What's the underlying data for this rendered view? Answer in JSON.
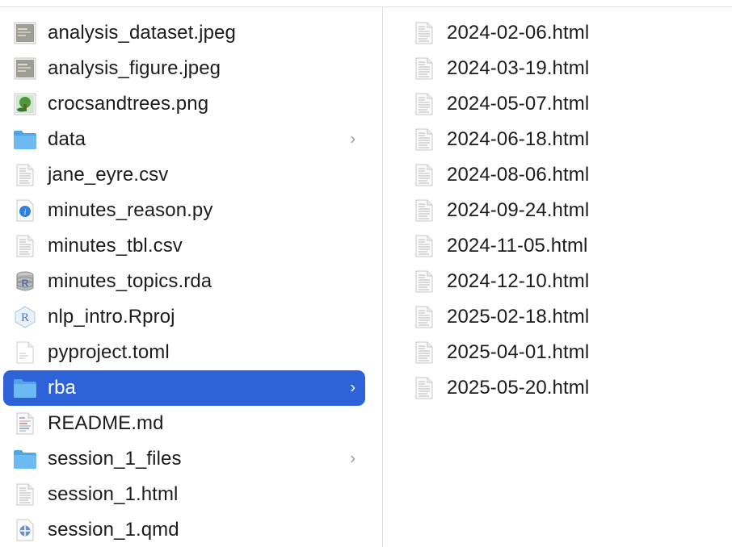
{
  "left_column": {
    "items": [
      {
        "name": "analysis_dataset.jpeg",
        "icon": "image-thumbnail-icon",
        "type": "image"
      },
      {
        "name": "analysis_figure.jpeg",
        "icon": "image-thumbnail-icon",
        "type": "image"
      },
      {
        "name": "crocsandtrees.png",
        "icon": "image-thumbnail-icon",
        "type": "image-color"
      },
      {
        "name": "data",
        "icon": "folder-icon",
        "type": "folder",
        "has_children": true
      },
      {
        "name": "jane_eyre.csv",
        "icon": "document-icon",
        "type": "doc"
      },
      {
        "name": "minutes_reason.py",
        "icon": "python-file-icon",
        "type": "python"
      },
      {
        "name": "minutes_tbl.csv",
        "icon": "document-icon",
        "type": "doc"
      },
      {
        "name": "minutes_topics.rda",
        "icon": "r-data-icon",
        "type": "rdata"
      },
      {
        "name": "nlp_intro.Rproj",
        "icon": "r-project-icon",
        "type": "rproj"
      },
      {
        "name": "pyproject.toml",
        "icon": "text-file-icon",
        "type": "text"
      },
      {
        "name": "rba",
        "icon": "folder-icon",
        "type": "folder",
        "has_children": true,
        "selected": true
      },
      {
        "name": "README.md",
        "icon": "markdown-file-icon",
        "type": "markdown"
      },
      {
        "name": "session_1_files",
        "icon": "folder-icon",
        "type": "folder",
        "has_children": true
      },
      {
        "name": "session_1.html",
        "icon": "document-icon",
        "type": "doc"
      },
      {
        "name": "session_1.qmd",
        "icon": "quarto-file-icon",
        "type": "quarto"
      }
    ]
  },
  "right_column": {
    "items": [
      {
        "name": "2024-02-06.html",
        "icon": "document-icon"
      },
      {
        "name": "2024-03-19.html",
        "icon": "document-icon"
      },
      {
        "name": "2024-05-07.html",
        "icon": "document-icon"
      },
      {
        "name": "2024-06-18.html",
        "icon": "document-icon"
      },
      {
        "name": "2024-08-06.html",
        "icon": "document-icon"
      },
      {
        "name": "2024-09-24.html",
        "icon": "document-icon"
      },
      {
        "name": "2024-11-05.html",
        "icon": "document-icon"
      },
      {
        "name": "2024-12-10.html",
        "icon": "document-icon"
      },
      {
        "name": "2025-02-18.html",
        "icon": "document-icon"
      },
      {
        "name": "2025-04-01.html",
        "icon": "document-icon"
      },
      {
        "name": "2025-05-20.html",
        "icon": "document-icon"
      }
    ]
  },
  "chevron": "›",
  "colors": {
    "selection": "#2d62d8",
    "folder": "#5fb3f0",
    "text": "#1d1d1f"
  }
}
